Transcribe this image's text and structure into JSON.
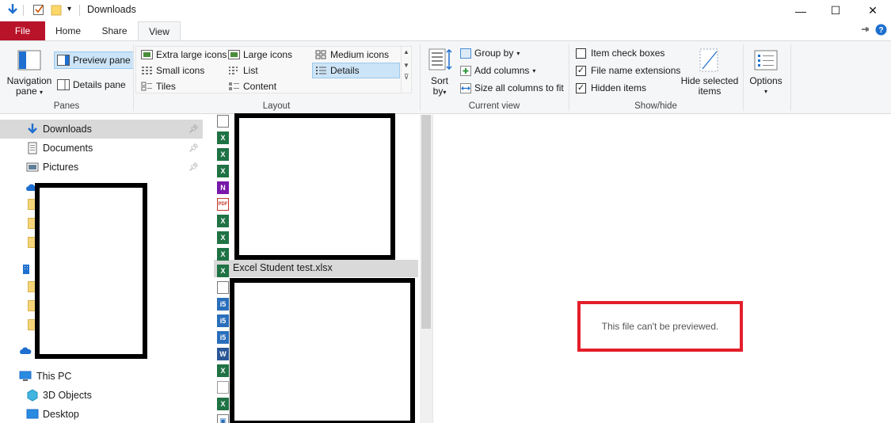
{
  "window": {
    "title": "Downloads",
    "controls": {
      "minimize": "—",
      "maximize": "☐",
      "close": "✕"
    }
  },
  "tabs": [
    {
      "label": "File"
    },
    {
      "label": "Home"
    },
    {
      "label": "Share"
    },
    {
      "label": "View"
    }
  ],
  "ribbon": {
    "panes": {
      "navigation_pane": "Navigation",
      "navigation_pane_2": "pane",
      "preview_pane": "Preview pane",
      "details_pane": "Details pane",
      "label": "Panes"
    },
    "layout": {
      "items": [
        {
          "label": "Extra large icons"
        },
        {
          "label": "Large icons"
        },
        {
          "label": "Medium icons"
        },
        {
          "label": "Small icons"
        },
        {
          "label": "List"
        },
        {
          "label": "Details"
        },
        {
          "label": "Tiles"
        },
        {
          "label": "Content"
        }
      ],
      "selected": "Details",
      "label": "Layout"
    },
    "current_view": {
      "sort_by": "Sort",
      "sort_by_2": "by",
      "group_by": "Group by",
      "add_columns": "Add columns",
      "size_all": "Size all columns to fit",
      "label": "Current view"
    },
    "show_hide": {
      "item_check_boxes": "Item check boxes",
      "file_name_extensions": "File name extensions",
      "hidden_items": "Hidden items",
      "hide_selected": "Hide selected",
      "hide_selected_2": "items",
      "label": "Show/hide",
      "checked": {
        "item_check_boxes": false,
        "file_name_extensions": true,
        "hidden_items": true
      }
    },
    "options": {
      "label": "Options"
    }
  },
  "nav": {
    "items": [
      {
        "label": "Downloads",
        "pinned": true
      },
      {
        "label": "Documents",
        "pinned": true
      },
      {
        "label": "Pictures",
        "pinned": true
      },
      {
        "label": "This PC"
      },
      {
        "label": "3D Objects"
      },
      {
        "label": "Desktop"
      }
    ]
  },
  "files": {
    "selected_name": "Excel Student test.xlsx",
    "icons": [
      "doc-icon",
      "excel-icon",
      "excel-icon",
      "excel-icon",
      "onenote-icon",
      "pdf-icon",
      "excel-icon",
      "excel-icon",
      "excel-icon",
      "excel-icon",
      "doc-icon",
      "exe-icon",
      "exe-icon",
      "exe-icon",
      "word-icon",
      "excel-icon",
      "blank-file-icon",
      "excel-icon",
      "image-file-icon"
    ]
  },
  "preview": {
    "message": "This file can't be previewed."
  },
  "colors": {
    "file_tab": "#b9132a",
    "selection": "#cce4f7",
    "highlight_box": "#e41e2b"
  }
}
